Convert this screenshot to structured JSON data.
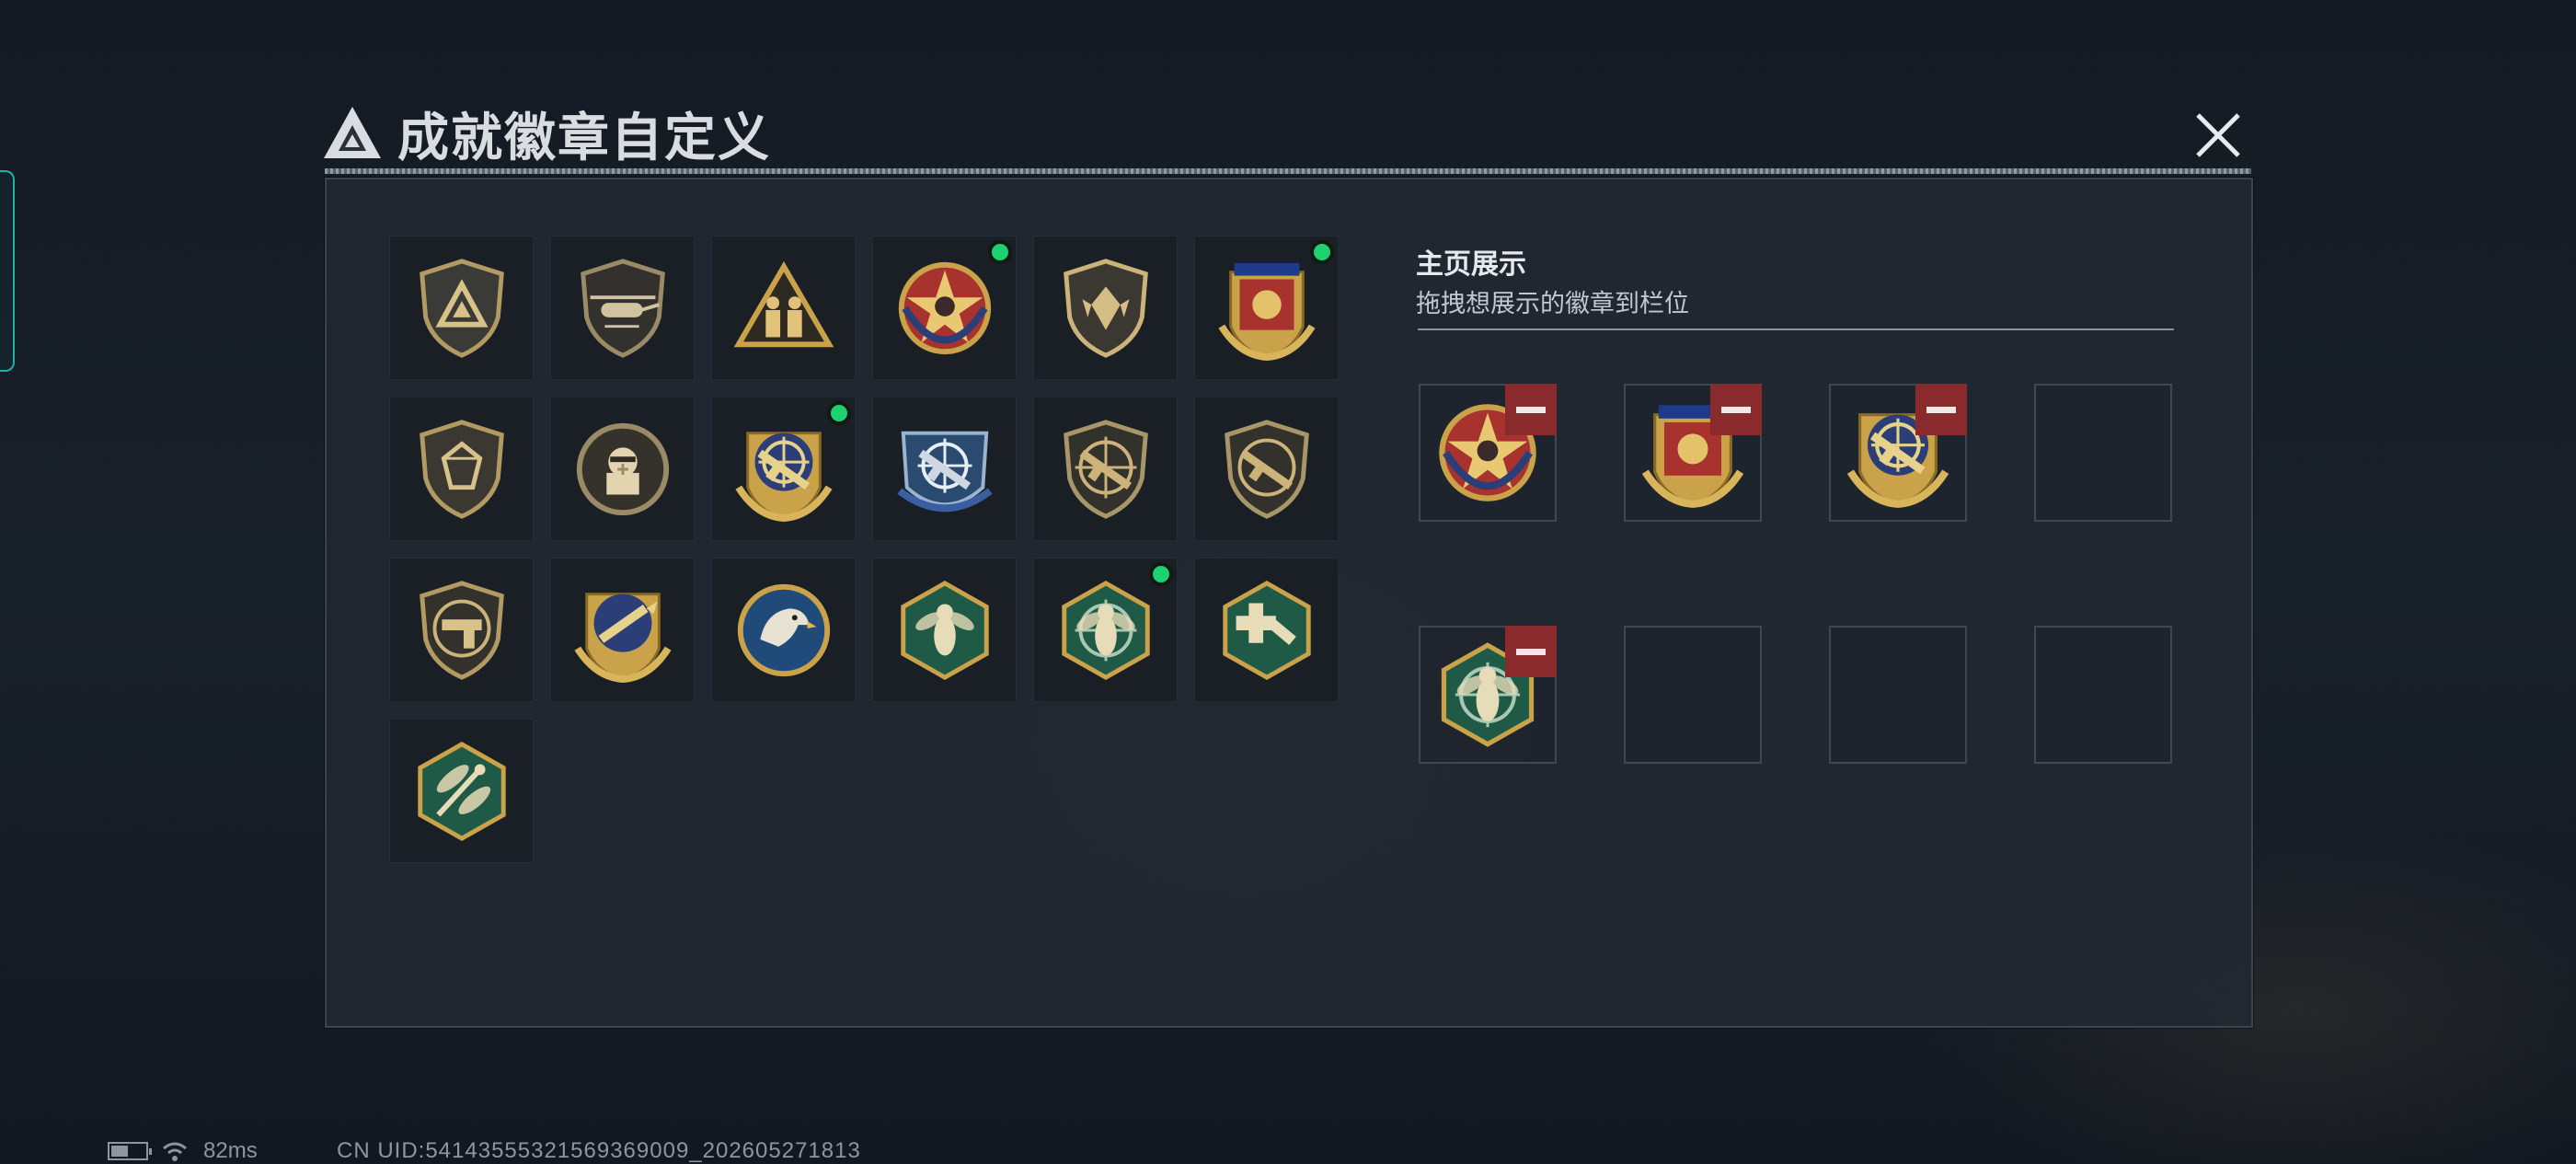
{
  "window": {
    "title": "成就徽章自定义"
  },
  "display_panel": {
    "title": "主页展示",
    "subtitle": "拖拽想展示的徽章到栏位"
  },
  "badges": [
    {
      "icon": "triangle-logo-shield-badge",
      "new": false
    },
    {
      "icon": "helicopter-badge",
      "new": false
    },
    {
      "icon": "soldiers-triangle-badge",
      "new": false
    },
    {
      "icon": "skull-star-round-badge",
      "new": true
    },
    {
      "icon": "wings-emblem-shield-badge",
      "new": false
    },
    {
      "icon": "red-gold-crest-badge",
      "new": true
    },
    {
      "icon": "gem-shield-badge",
      "new": false
    },
    {
      "icon": "soldier-crosshair-badge",
      "new": false
    },
    {
      "icon": "rifle-crosshair-gold-badge",
      "new": true
    },
    {
      "icon": "sniper-crosshair-blue-badge",
      "new": false
    },
    {
      "icon": "rifle-scope-shield-badge",
      "new": false
    },
    {
      "icon": "smg-scope-shield-badge",
      "new": false
    },
    {
      "icon": "pistol-shield-badge",
      "new": false
    },
    {
      "icon": "rocket-gold-crest-badge",
      "new": false
    },
    {
      "icon": "eagle-blue-badge",
      "new": false
    },
    {
      "icon": "hornet-hex-badge",
      "new": false
    },
    {
      "icon": "hornet-crosshair-hex-badge",
      "new": true
    },
    {
      "icon": "medic-hammer-hex-badge",
      "new": false
    },
    {
      "icon": "dragonfly-hex-badge",
      "new": false
    }
  ],
  "display_slots": [
    {
      "icon": "skull-star-round-badge",
      "filled": true
    },
    {
      "icon": "red-gold-crest-badge",
      "filled": true
    },
    {
      "icon": "rifle-crosshair-gold-badge",
      "filled": true
    },
    {
      "icon": "",
      "filled": false
    },
    {
      "icon": "hornet-crosshair-hex-badge",
      "filled": true
    },
    {
      "icon": "",
      "filled": false
    },
    {
      "icon": "",
      "filled": false
    },
    {
      "icon": "",
      "filled": false
    }
  ],
  "status_bar": {
    "battery_level": 0.5,
    "ping": "82ms",
    "uid": "CN UID:5414355532156936900​9_202605271813"
  },
  "colors": {
    "accent_new": "#1ed16f",
    "remove": "#8a2a2c",
    "gold": "#c9a24a",
    "panel": "#222831"
  }
}
